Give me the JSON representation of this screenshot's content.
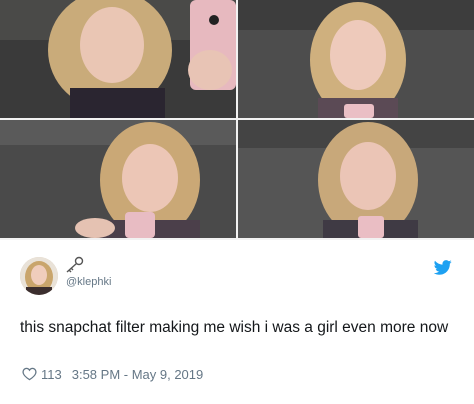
{
  "tweet": {
    "handle": "@klephki",
    "text": "this snapchat filter making me wish i was a girl even more now",
    "likes": "113",
    "timestamp": "3:58 PM - May 9, 2019"
  },
  "icons": {
    "avatar": "user-avatar-photo",
    "emoji": "key-icon",
    "platform": "twitter-bird-icon",
    "like": "heart-icon"
  },
  "colors": {
    "twitter_blue": "#1da1f2",
    "meta_gray": "#657786",
    "text_dark": "#14171a"
  }
}
